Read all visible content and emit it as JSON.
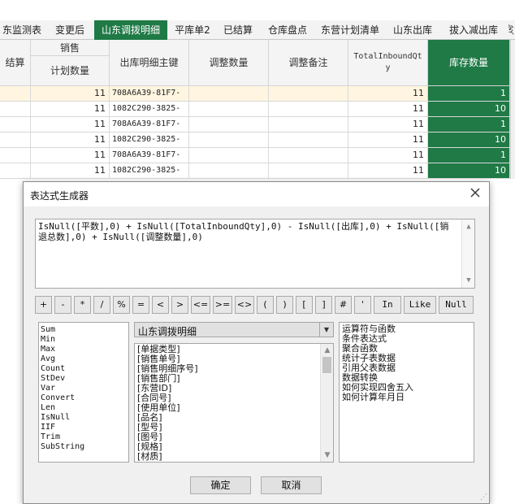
{
  "tabs": [
    {
      "label": "东监测表",
      "active": false
    },
    {
      "label": "变更后",
      "active": false
    },
    {
      "label": "山东调拨明细",
      "active": true
    },
    {
      "label": "平库单2",
      "active": false
    },
    {
      "label": "已结算",
      "active": false
    },
    {
      "label": "仓库盘点",
      "active": false
    },
    {
      "label": "东营计划清单",
      "active": false
    },
    {
      "label": "山东出库",
      "active": false
    },
    {
      "label": "拔入减出库",
      "active": false
    },
    {
      "label": "ই",
      "active": false
    }
  ],
  "grid": {
    "headers": {
      "jiesuan": "结算",
      "xiaoshou": "销售",
      "jihua_shuliang": "计划数量",
      "chuku_zhujian": "出库明细主键",
      "tiaozheng_shuliang": "调整数量",
      "tiaozheng_beizhu": "调整备注",
      "total_inbound": "TotalInboundQty",
      "kucun_shuliang": "库存数量"
    },
    "rows": [
      {
        "plan_qty": "11",
        "key": "708A6A39-81F7-",
        "total": "11",
        "stock": "1",
        "highlight": true
      },
      {
        "plan_qty": "11",
        "key": "1082C290-3825-",
        "total": "11",
        "stock": "10",
        "highlight": false
      },
      {
        "plan_qty": "11",
        "key": "708A6A39-81F7-",
        "total": "11",
        "stock": "1",
        "highlight": false
      },
      {
        "plan_qty": "11",
        "key": "1082C290-3825-",
        "total": "11",
        "stock": "10",
        "highlight": false
      },
      {
        "plan_qty": "11",
        "key": "708A6A39-81F7-",
        "total": "11",
        "stock": "1",
        "highlight": false
      },
      {
        "plan_qty": "11",
        "key": "1082C290-3825-",
        "total": "11",
        "stock": "10",
        "highlight": false
      }
    ]
  },
  "dialog": {
    "title": "表达式生成器",
    "close_icon": "close-icon",
    "expression": "IsNull([平数],0) + IsNull([TotalInboundQty],0) - IsNull([出库],0) + IsNull([销退总数],0) + IsNull([调整数量],0)",
    "operators": [
      "+",
      "-",
      "*",
      "/",
      "%",
      "=",
      "<",
      ">",
      "<=",
      ">=",
      "<>",
      "(",
      ")",
      "[",
      "]",
      "#",
      "'",
      "In",
      "Like",
      "Null"
    ],
    "functions": [
      "Sum",
      "Min",
      "Max",
      "Avg",
      "Count",
      "StDev",
      "Var",
      "Convert",
      "Len",
      "IsNull",
      "IIF",
      "Trim",
      "SubString"
    ],
    "table_select": "山东调拨明细",
    "fields": [
      "[单据类型]",
      "[销售单号]",
      "[销售明细序号]",
      "[销售部门]",
      "[东营ID]",
      "[合同号]",
      "[使用单位]",
      "[品名]",
      "[型号]",
      "[图号]",
      "[规格]",
      "[材质]"
    ],
    "help_items": [
      "运算符与函数",
      "条件表达式",
      "聚合函数",
      "统计子表数据",
      "引用父表数据",
      "数据转换",
      "如何实现四舍五入",
      "如何计算年月日"
    ],
    "ok_label": "确定",
    "cancel_label": "取消"
  }
}
